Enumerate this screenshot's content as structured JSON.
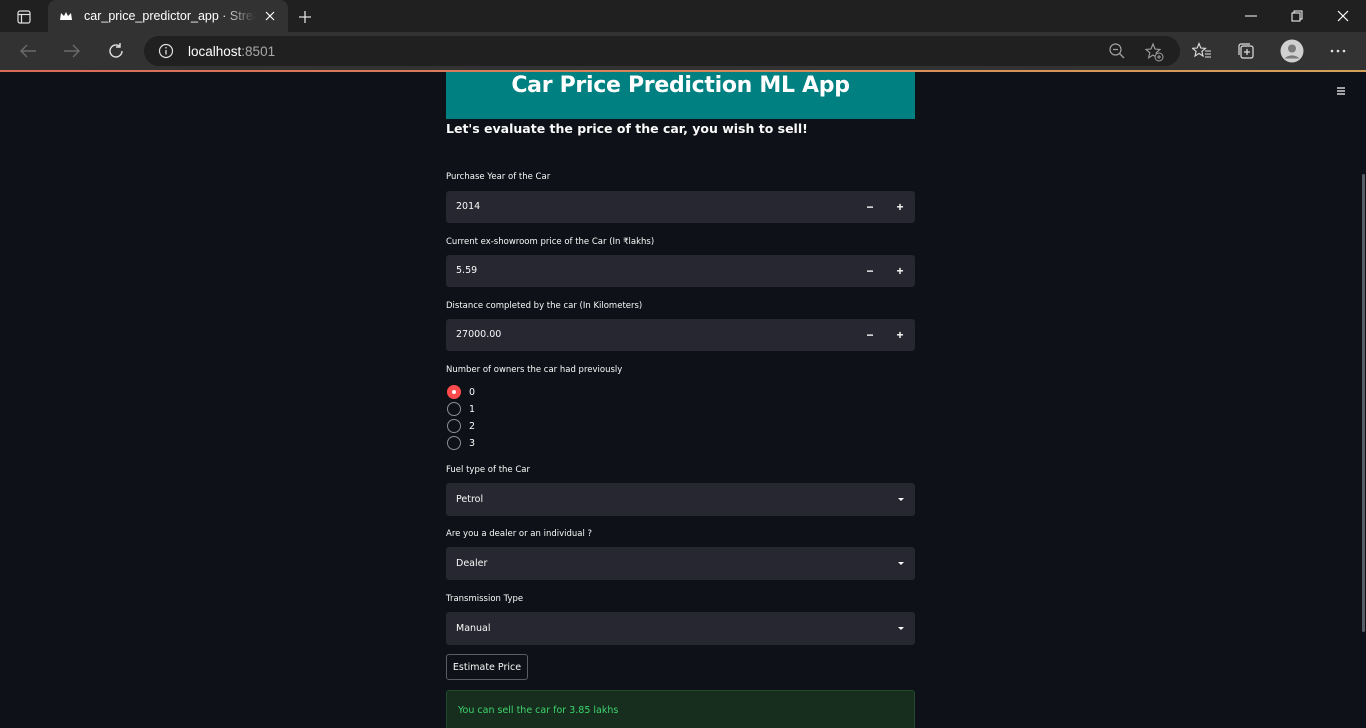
{
  "browser": {
    "tab_title": "car_price_predictor_app · Streamlit",
    "url_host": "localhost",
    "url_port": ":8501"
  },
  "app": {
    "title": "Car Price Prediction ML App",
    "subtitle": "Let's evaluate the price of the car, you wish to sell!",
    "fields": {
      "purchase_year": {
        "label": "Purchase Year of the Car",
        "value": "2014"
      },
      "showroom_price": {
        "label": "Current ex-showroom price of the Car (In ₹lakhs)",
        "value": "5.59"
      },
      "distance": {
        "label": "Distance completed by the car (In Kilometers)",
        "value": "27000.00"
      },
      "owners": {
        "label": "Number of owners the car had previously",
        "options": [
          "0",
          "1",
          "2",
          "3"
        ],
        "selected": "0"
      },
      "fuel_type": {
        "label": "Fuel type of the Car",
        "value": "Petrol"
      },
      "seller_type": {
        "label": "Are you a dealer or an individual ?",
        "value": "Dealer"
      },
      "transmission": {
        "label": "Transmission Type",
        "value": "Manual"
      }
    },
    "step_minus": "−",
    "step_plus": "+",
    "estimate_button": "Estimate Price",
    "result": "You can sell the car for 3.85 lakhs"
  },
  "colors": {
    "header_bg": "#008080",
    "accent": "#ff4b4b",
    "success_text": "#3dd56d",
    "app_bg": "#0e1117"
  }
}
